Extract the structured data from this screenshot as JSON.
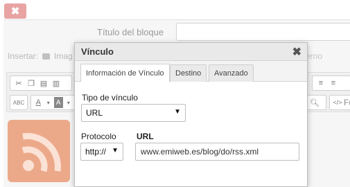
{
  "background": {
    "close_glyph": "✖",
    "title_label": "Título del bloque",
    "title_value": "",
    "insert_label": "Insertar:",
    "insert_image_partial": "Imag",
    "right_partial_text": "erno",
    "toolbar_partial_text": "Fu",
    "icons": [
      "cut-icon",
      "copy-icon",
      "paste-icon",
      "paste-text-icon",
      "spellcheck-icon",
      "font-color-icon",
      "bg-color-icon",
      "align-center-icon",
      "align-right-icon",
      "preview-icon",
      "source-icon",
      "rss-icon"
    ]
  },
  "dialog": {
    "title": "Vínculo",
    "close_glyph": "✖",
    "tabs": [
      {
        "label": "Información de Vínculo",
        "active": true
      },
      {
        "label": "Destino",
        "active": false
      },
      {
        "label": "Avanzado",
        "active": false
      }
    ],
    "link_type_label": "Tipo de vínculo",
    "link_type_value": "URL",
    "protocol_label": "Protocolo",
    "protocol_value": "http://",
    "url_label": "URL",
    "url_value": "www.emiweb.es/blog/do/rss.xml",
    "dropdown_arrow": "▼"
  },
  "colors": {
    "close_button": "#e8a3a3",
    "rss_thumbnail": "#eca98a",
    "dialog_titlebar": "#e9e9e9"
  }
}
